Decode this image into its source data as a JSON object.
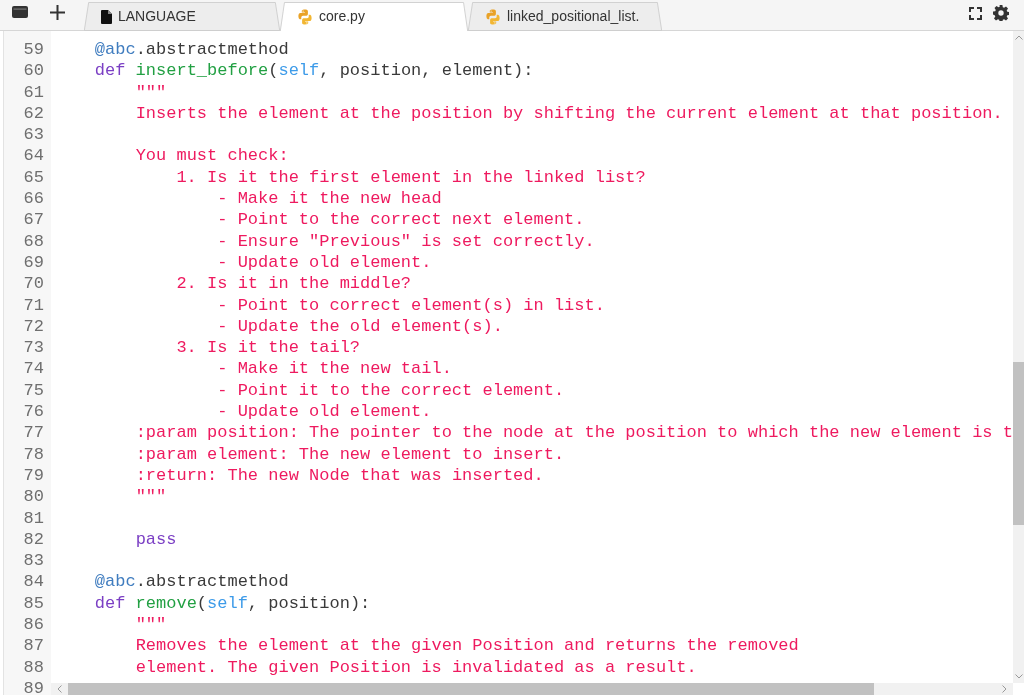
{
  "tabs": [
    {
      "label": "LANGUAGE",
      "kind": "file",
      "selected": false
    },
    {
      "label": "core.py",
      "kind": "python",
      "selected": true
    },
    {
      "label": "linked_positional_list.",
      "kind": "python",
      "selected": false
    }
  ],
  "editor": {
    "lines": [
      {
        "number": "59",
        "tokens": [
          {
            "kind": "decorator",
            "text": "    @abc"
          },
          {
            "kind": "plain",
            "text": ".abstractmethod"
          }
        ]
      },
      {
        "number": "60",
        "tokens": [
          {
            "kind": "keyword",
            "text": "    def"
          },
          {
            "kind": "function",
            "text": " insert_before"
          },
          {
            "kind": "plain",
            "text": "("
          },
          {
            "kind": "self",
            "text": "self"
          },
          {
            "kind": "plain",
            "text": ", position, element):"
          }
        ]
      },
      {
        "number": "61",
        "tokens": [
          {
            "kind": "string",
            "text": "        \"\"\""
          }
        ]
      },
      {
        "number": "62",
        "tokens": [
          {
            "kind": "string",
            "text": "        Inserts the element at the position by shifting the current element at that position."
          }
        ]
      },
      {
        "number": "63"
      },
      {
        "number": "64",
        "tokens": [
          {
            "kind": "string",
            "text": "        You must check:"
          }
        ]
      },
      {
        "number": "65",
        "tokens": [
          {
            "kind": "string",
            "text": "            1. Is it the first element in the linked list?"
          }
        ]
      },
      {
        "number": "66",
        "tokens": [
          {
            "kind": "string",
            "text": "                - Make it the new head"
          }
        ]
      },
      {
        "number": "67",
        "tokens": [
          {
            "kind": "string",
            "text": "                - Point to the correct next element."
          }
        ]
      },
      {
        "number": "68",
        "tokens": [
          {
            "kind": "string",
            "text": "                - Ensure \"Previous\" is set correctly."
          }
        ]
      },
      {
        "number": "69",
        "tokens": [
          {
            "kind": "string",
            "text": "                - Update old element."
          }
        ]
      },
      {
        "number": "70",
        "tokens": [
          {
            "kind": "string",
            "text": "            2. Is it in the middle?"
          }
        ]
      },
      {
        "number": "71",
        "tokens": [
          {
            "kind": "string",
            "text": "                - Point to correct element(s) in list."
          }
        ]
      },
      {
        "number": "72",
        "tokens": [
          {
            "kind": "string",
            "text": "                - Update the old element(s)."
          }
        ]
      },
      {
        "number": "73",
        "tokens": [
          {
            "kind": "string",
            "text": "            3. Is it the tail?"
          }
        ]
      },
      {
        "number": "74",
        "tokens": [
          {
            "kind": "string",
            "text": "                - Make it the new tail."
          }
        ]
      },
      {
        "number": "75",
        "tokens": [
          {
            "kind": "string",
            "text": "                - Point it to the correct element."
          }
        ]
      },
      {
        "number": "76",
        "tokens": [
          {
            "kind": "string",
            "text": "                - Update old element."
          }
        ]
      },
      {
        "number": "77",
        "tokens": [
          {
            "kind": "string",
            "text": "        :param position: The pointer to the node at the position to which the new element is t"
          }
        ]
      },
      {
        "number": "78",
        "tokens": [
          {
            "kind": "string",
            "text": "        :param element: The new element to insert."
          }
        ]
      },
      {
        "number": "79",
        "tokens": [
          {
            "kind": "string",
            "text": "        :return: The new Node that was inserted."
          }
        ]
      },
      {
        "number": "80",
        "tokens": [
          {
            "kind": "string",
            "text": "        \"\"\""
          }
        ]
      },
      {
        "number": "81"
      },
      {
        "number": "82",
        "tokens": [
          {
            "kind": "keyword",
            "text": "        pass"
          }
        ]
      },
      {
        "number": "83"
      },
      {
        "number": "84",
        "tokens": [
          {
            "kind": "decorator",
            "text": "    @abc"
          },
          {
            "kind": "plain",
            "text": ".abstractmethod"
          }
        ]
      },
      {
        "number": "85",
        "tokens": [
          {
            "kind": "keyword",
            "text": "    def"
          },
          {
            "kind": "function",
            "text": " remove"
          },
          {
            "kind": "plain",
            "text": "("
          },
          {
            "kind": "self",
            "text": "self"
          },
          {
            "kind": "plain",
            "text": ", position):"
          }
        ]
      },
      {
        "number": "86",
        "tokens": [
          {
            "kind": "string",
            "text": "        \"\"\""
          }
        ]
      },
      {
        "number": "87",
        "tokens": [
          {
            "kind": "string",
            "text": "        Removes the element at the given Position and returns the removed"
          }
        ]
      },
      {
        "number": "88",
        "tokens": [
          {
            "kind": "string",
            "text": "        element. The given Position is invalidated as a result."
          }
        ]
      },
      {
        "number": "89"
      }
    ]
  }
}
